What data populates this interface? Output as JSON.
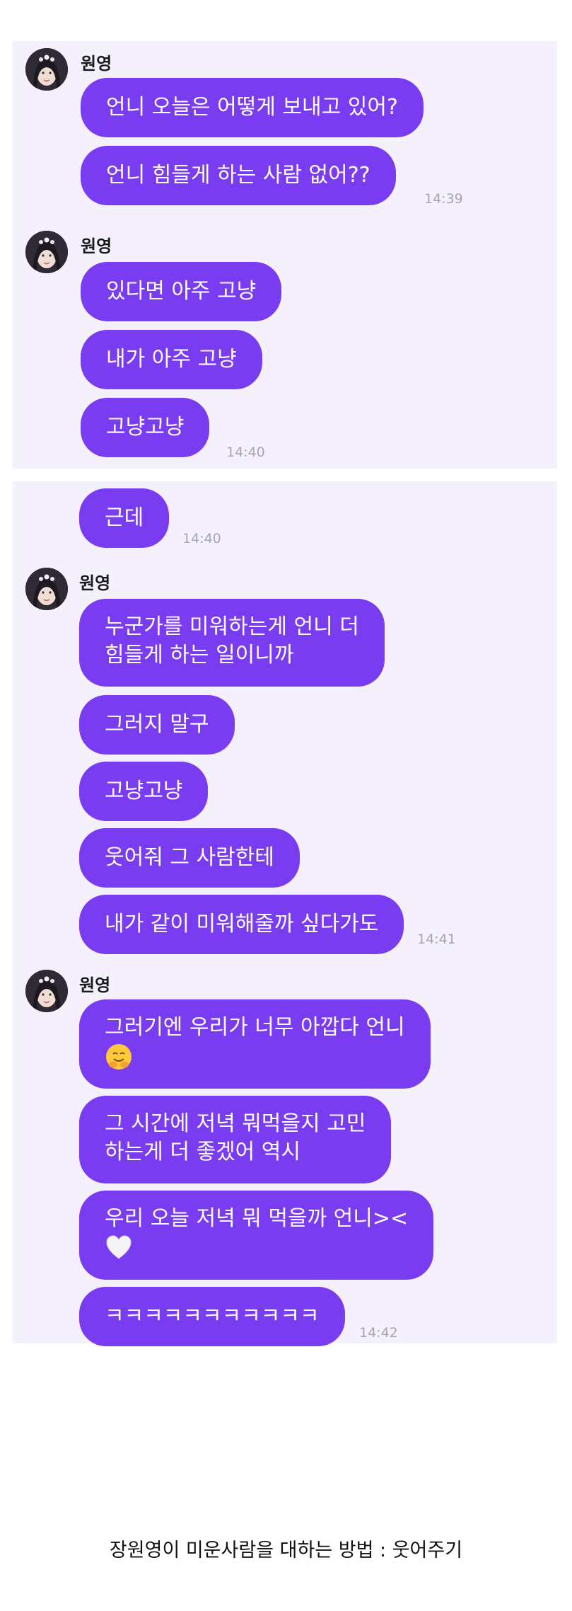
{
  "panels": [
    {
      "groups": [
        {
          "sender": "원영",
          "messages": [
            {
              "lines": [
                "언니 오늘은 어떻게 보내고 있어?"
              ]
            },
            {
              "lines": [
                "언니 힘들게 하는 사람 없어??"
              ]
            }
          ],
          "time": "14:39"
        },
        {
          "sender": "원영",
          "messages": [
            {
              "lines": [
                "있다면 아주 고냥"
              ]
            },
            {
              "lines": [
                "내가 아주 고냥"
              ]
            },
            {
              "lines": [
                "고냥고냥"
              ]
            }
          ],
          "time": "14:40"
        }
      ]
    },
    {
      "groups": [
        {
          "sender": "",
          "messages": [
            {
              "lines": [
                "근데"
              ]
            }
          ],
          "time": "14:40"
        },
        {
          "sender": "원영",
          "messages": [
            {
              "lines": [
                "누군가를 미워하는게 언니 더",
                "힘들게 하는 일이니까"
              ]
            },
            {
              "lines": [
                "그러지 말구"
              ]
            },
            {
              "lines": [
                "고냥고냥"
              ]
            },
            {
              "lines": [
                "웃어줘 그 사람한테"
              ]
            },
            {
              "lines": [
                "내가 같이 미워해줄까 싶다가도"
              ]
            }
          ],
          "time": "14:41"
        },
        {
          "sender": "원영",
          "messages": [
            {
              "lines": [
                "그러기엔 우리가 너무 아깝다 언니",
                ""
              ],
              "emoji": "hugging-face-emoji"
            },
            {
              "lines": [
                "그 시간에 저녁 뭐먹을지 고민",
                "하는게 더 좋겠어 역시"
              ]
            },
            {
              "lines": [
                "우리 오늘 저녁 뭐 먹을까 언니><",
                ""
              ],
              "emoji": "white-heart-emoji"
            },
            {
              "lines": [
                "ㅋㅋㅋㅋㅋㅋㅋㅋㅋㅋㅋ"
              ]
            }
          ],
          "time": "14:42"
        }
      ]
    }
  ],
  "caption": "장원영이 미운사람을 대하는 방법 : 웃어주기",
  "colors": {
    "bubble": "#7a3cf0",
    "bubble_text": "#ffffff",
    "panel_background": "#f4f1fd",
    "timestamp": "#a8a3b6",
    "sender_name": "#1b1b1b"
  }
}
